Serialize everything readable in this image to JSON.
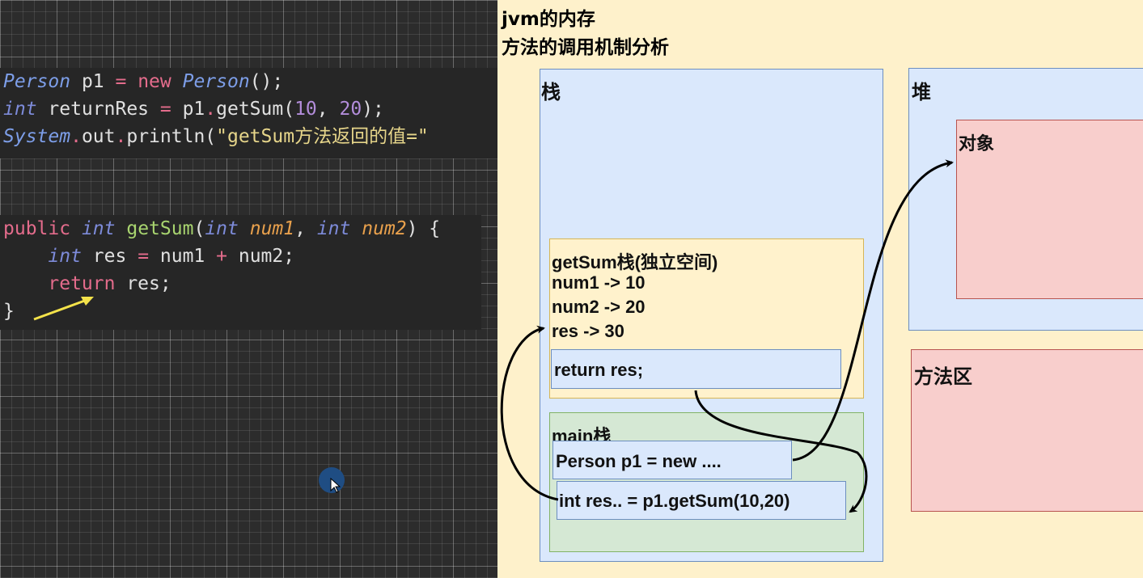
{
  "code": {
    "block1": [
      [
        [
          "cls",
          "Person"
        ],
        [
          "plain",
          " p1 "
        ],
        [
          "op",
          "="
        ],
        [
          "plain",
          " "
        ],
        [
          "kw",
          "new"
        ],
        [
          "plain",
          " "
        ],
        [
          "cls",
          "Person"
        ],
        [
          "plain",
          "();"
        ]
      ],
      [
        [
          "type",
          "int"
        ],
        [
          "plain",
          " returnRes "
        ],
        [
          "op",
          "="
        ],
        [
          "plain",
          " p1"
        ],
        [
          "op",
          "."
        ],
        [
          "plain",
          "getSum("
        ],
        [
          "num",
          "10"
        ],
        [
          "plain",
          ", "
        ],
        [
          "num",
          "20"
        ],
        [
          "plain",
          ");"
        ]
      ],
      [
        [
          "cls",
          "System"
        ],
        [
          "op",
          "."
        ],
        [
          "plain",
          "out"
        ],
        [
          "op",
          "."
        ],
        [
          "plain",
          "println("
        ],
        [
          "str",
          "\"getSum方法返回的值=\""
        ]
      ]
    ],
    "block2": [
      [
        [
          "kw",
          "public"
        ],
        [
          "plain",
          " "
        ],
        [
          "type",
          "int"
        ],
        [
          "plain",
          " "
        ],
        [
          "fn",
          "getSum"
        ],
        [
          "plain",
          "("
        ],
        [
          "type",
          "int"
        ],
        [
          "plain",
          " "
        ],
        [
          "param",
          "num1"
        ],
        [
          "plain",
          ", "
        ],
        [
          "type",
          "int"
        ],
        [
          "plain",
          " "
        ],
        [
          "param",
          "num2"
        ],
        [
          "plain",
          ") {"
        ]
      ],
      [
        [
          "plain",
          "    "
        ],
        [
          "type",
          "int"
        ],
        [
          "plain",
          " res "
        ],
        [
          "op",
          "="
        ],
        [
          "plain",
          " num1 "
        ],
        [
          "op",
          "+"
        ],
        [
          "plain",
          " num2;"
        ]
      ],
      [
        [
          "plain",
          "    "
        ],
        [
          "kw",
          "return"
        ],
        [
          "plain",
          " res;"
        ]
      ],
      [
        [
          "plain",
          "}"
        ]
      ]
    ]
  },
  "diagram": {
    "title_line1": "jvm的内存",
    "title_line2": "方法的调用机制分析",
    "stack_label": "栈",
    "heap_label": "堆",
    "object_label": "对象",
    "method_area_label": "方法区",
    "getsum_frame": {
      "title": "getSum栈(独立空间)",
      "var1": "num1 -> 10",
      "var2": "num2 -> 20",
      "var3": "res -> 30",
      "return_stmt": "return res;"
    },
    "main_frame": {
      "title": "main栈",
      "stmt1": "Person p1 = new ....",
      "stmt2": "int res.. = p1.getSum(10,20)"
    }
  },
  "colors": {
    "stack_fill": "#dae8fc",
    "stack_border": "#6c8ebf",
    "frame_fill": "#fff2cc",
    "frame_border": "#d6b656",
    "main_fill": "#d5e8d4",
    "main_border": "#82b366",
    "heap_obj_fill": "#f8cecc",
    "heap_obj_border": "#b85450"
  }
}
